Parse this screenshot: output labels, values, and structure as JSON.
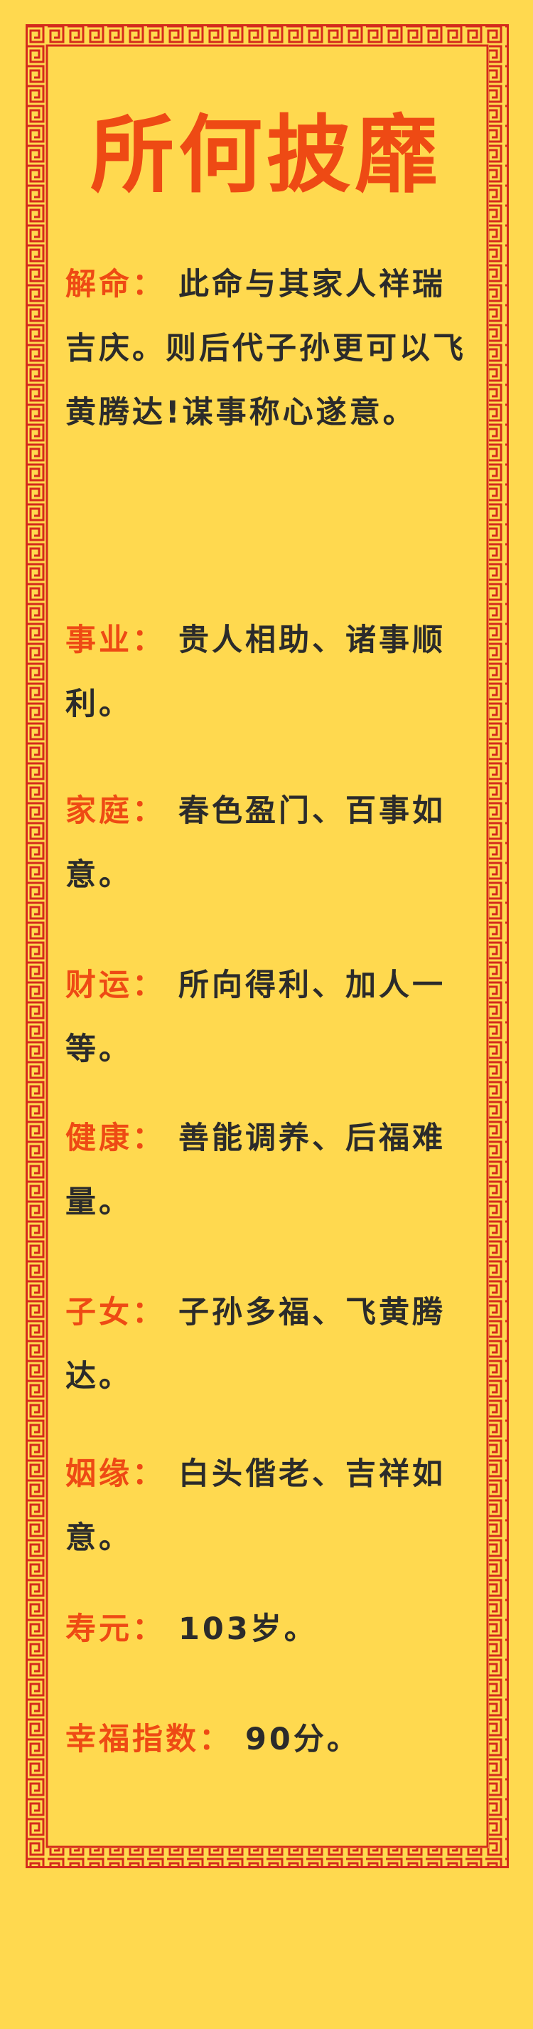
{
  "title": "所何披靡",
  "colors": {
    "background": "#FFD94F",
    "accent": "#EE4A14",
    "border": "#D42A1C",
    "text": "#2B2B2B"
  },
  "sections": [
    {
      "label": "解命",
      "text": "此命与其家人祥瑞吉庆。则后代子孙更可以飞黄腾达!谋事称心遂意。"
    },
    {
      "label": "事业",
      "text": "贵人相助、诸事顺利。"
    },
    {
      "label": "家庭",
      "text": "春色盈门、百事如意。"
    },
    {
      "label": "财运",
      "text": "所向得利、加人一等。"
    },
    {
      "label": "健康",
      "text": "善能调养、后福难量。"
    },
    {
      "label": "子女",
      "text": "子孙多福、飞黄腾达。"
    },
    {
      "label": "姻缘",
      "text": "白头偕老、吉祥如意。"
    },
    {
      "label": "寿元",
      "text": "103岁。"
    },
    {
      "label": "幸福指数",
      "text": "90分。"
    }
  ],
  "separator": "："
}
